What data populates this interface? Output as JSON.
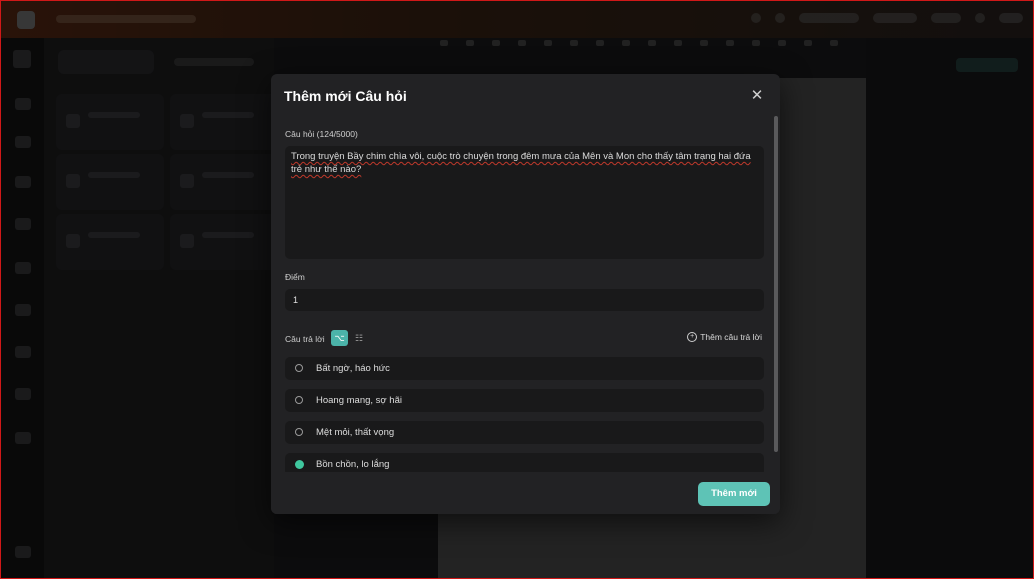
{
  "modal": {
    "title": "Thêm mới Câu hỏi",
    "close_icon": "close-icon",
    "question_label": "Câu hỏi (124/5000)",
    "question_text": "Trong truyện Bầy chim chìa vôi, cuộc trò chuyện trong đêm mưa của Mên và Mon cho thấy tâm trạng hai đứa trẻ như thế nào?",
    "score_label": "Điểm",
    "score_value": "1",
    "answers_label": "Câu trả lời",
    "add_answer_label": "Thêm câu trả lời",
    "answers": [
      {
        "text": "Bất ngờ, háo hức",
        "selected": false
      },
      {
        "text": "Hoang mang, sợ hãi",
        "selected": false
      },
      {
        "text": "Mệt mỏi, thất vọng",
        "selected": false
      },
      {
        "text": "Bồn chồn, lo lắng",
        "selected": true
      }
    ],
    "submit_label": "Thêm mới"
  },
  "colors": {
    "accent": "#5ec3b6",
    "selected_radio": "#3fc79e",
    "border": "#d01818"
  }
}
